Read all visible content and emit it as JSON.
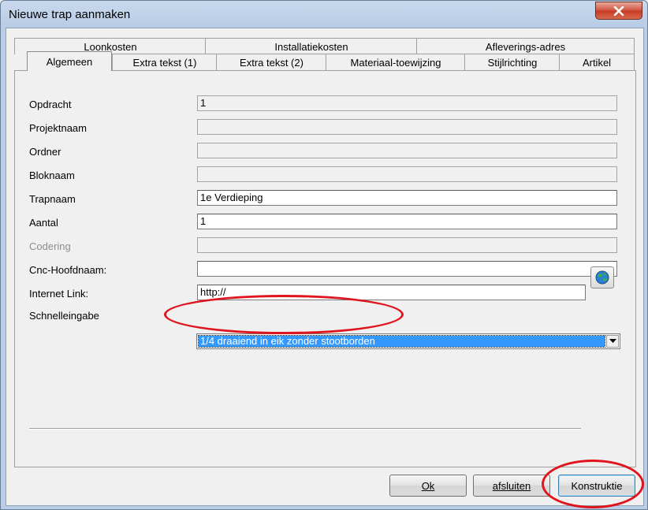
{
  "window": {
    "title": "Nieuwe trap aanmaken"
  },
  "tabs": {
    "row1": [
      {
        "label": "Loonkosten"
      },
      {
        "label": "Installatiekosten"
      },
      {
        "label": "Afleverings-adres"
      }
    ],
    "row2": [
      {
        "label": "Algemeen",
        "active": true
      },
      {
        "label": "Extra tekst (1)"
      },
      {
        "label": "Extra tekst (2)"
      },
      {
        "label": "Materiaal-toewijzing"
      },
      {
        "label": "Stijlrichting"
      },
      {
        "label": "Artikel"
      }
    ]
  },
  "form": {
    "opdracht": {
      "label": "Opdracht",
      "value": "1"
    },
    "projektnaam": {
      "label": "Projektnaam",
      "value": ""
    },
    "ordner": {
      "label": "Ordner",
      "value": ""
    },
    "bloknaam": {
      "label": "Bloknaam",
      "value": ""
    },
    "trapnaam": {
      "label": "Trapnaam",
      "value": "1e Verdieping"
    },
    "aantal": {
      "label": "Aantal",
      "value": "1"
    },
    "codering": {
      "label": "Codering",
      "value": ""
    },
    "cnc": {
      "label": "Cnc-Hoofdnaam:",
      "value": ""
    },
    "internet": {
      "label": "Internet Link:",
      "value": "http://"
    },
    "schnelleingabe": {
      "label": "Schnelleingabe",
      "value": "1/4 draaiend in eik zonder stootborden"
    }
  },
  "buttons": {
    "ok": "Ok",
    "afsluiten": "afsluiten",
    "konstruktie": "Konstruktie"
  },
  "colors": {
    "selection": "#3399ff",
    "annotation": "#e0141c",
    "close_button": "#c53a23"
  }
}
